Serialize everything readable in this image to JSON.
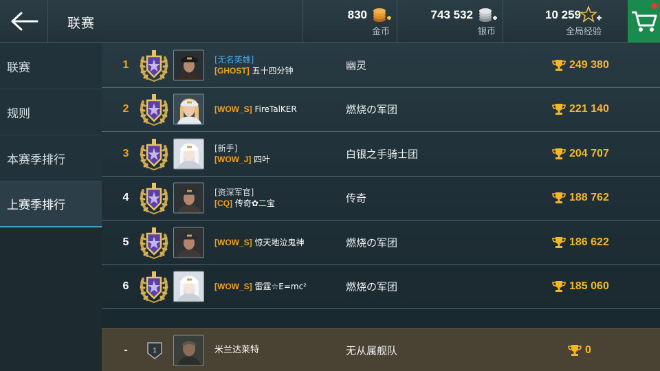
{
  "header": {
    "title": "联赛",
    "gold": {
      "value": "830",
      "label": "金币"
    },
    "silver": {
      "value": "743 532",
      "label": "银币"
    },
    "xp": {
      "value": "10 259",
      "label": "全局经验"
    }
  },
  "sidebar": {
    "items": [
      {
        "label": "联赛"
      },
      {
        "label": "规则"
      },
      {
        "label": "本赛季排行"
      },
      {
        "label": "上赛季排行"
      }
    ],
    "active_index": 3
  },
  "ranking": {
    "rows": [
      {
        "rank": "1",
        "title": "[无名英雄]",
        "clan": "[GHOST]",
        "name": "五十四分钟",
        "team": "幽灵",
        "score": "249 380"
      },
      {
        "rank": "2",
        "title": "",
        "clan": "[WOW_S]",
        "name": "FireTalKER",
        "team": "燃烧の军团",
        "score": "221 140"
      },
      {
        "rank": "3",
        "title": "[新手]",
        "clan": "[WOW_J]",
        "name": "四叶",
        "team": "白银之手骑士团",
        "score": "204 707"
      },
      {
        "rank": "4",
        "title": "[资深军官]",
        "clan": "[CQ]",
        "name": "传奇✿二宝",
        "team": "传奇",
        "score": "188 762"
      },
      {
        "rank": "5",
        "title": "",
        "clan": "[WOW_S]",
        "name": "惊天地泣鬼神",
        "team": "燃烧の军团",
        "score": "186 622"
      },
      {
        "rank": "6",
        "title": "",
        "clan": "[WOW_S]",
        "name": "雷霆☆E=mc²",
        "team": "燃烧の军团",
        "score": "185 060"
      }
    ],
    "rank_colors": [
      "#f0a020",
      "#f0a020",
      "#f0a020",
      "#ffffff",
      "#ffffff",
      "#ffffff"
    ]
  },
  "my_row": {
    "rank": "-",
    "badge_level": "1",
    "name": "米兰达莱特",
    "team": "无从属舰队",
    "score": "0"
  },
  "colors": {
    "accent_orange": "#f0a020",
    "score_gold": "#f5b72a",
    "cart_green": "#1a8a4e",
    "title_blue": "#4fa8e3"
  }
}
